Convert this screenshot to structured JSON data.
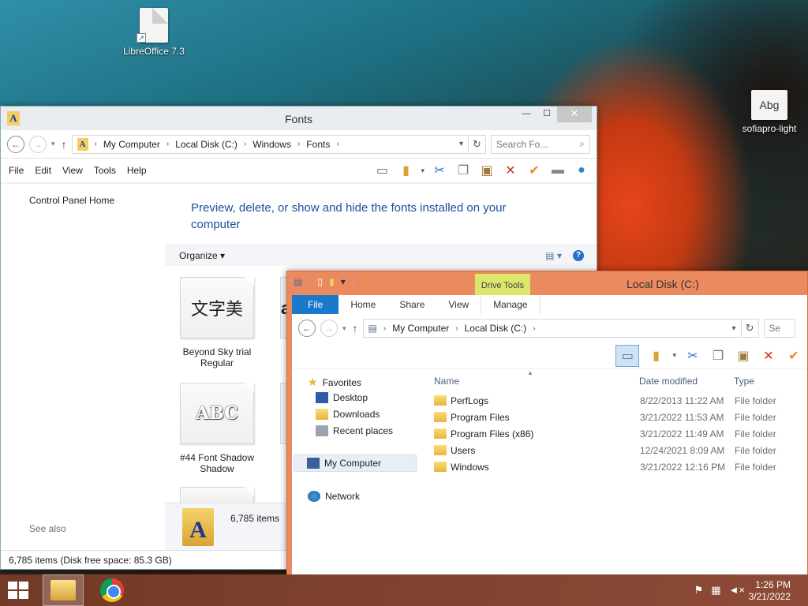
{
  "desktop": {
    "icons": [
      {
        "label": "LibreOffice 7.3"
      },
      {
        "label": "sofiapro-light",
        "glyph": "Abg"
      }
    ]
  },
  "fonts_window": {
    "title": "Fonts",
    "address": [
      "My Computer",
      "Local Disk (C:)",
      "Windows",
      "Fonts"
    ],
    "search_placeholder": "Search Fo...",
    "menu": [
      "File",
      "Edit",
      "View",
      "Tools",
      "Help"
    ],
    "left_pane": {
      "home": "Control Panel Home",
      "see_also": "See also"
    },
    "headline": "Preview, delete, or show and hide the fonts installed on your computer",
    "organize": "Organize",
    "fonts": [
      {
        "preview": "文字美",
        "name": "Beyond Sky trial Regular"
      },
      {
        "preview": "ABC",
        "name": "#44 Font Shadow Shadow"
      }
    ],
    "partial_previews": [
      "a"
    ],
    "details_count": "6,785 items",
    "status": "6,785 items (Disk free space: 85.3 GB)"
  },
  "disk_window": {
    "title": "Local Disk (C:)",
    "context_tab": "Drive Tools",
    "tabs": [
      "File",
      "Home",
      "Share",
      "View",
      "Manage"
    ],
    "address": [
      "My Computer",
      "Local Disk (C:)"
    ],
    "search_partial": "Se",
    "nav": {
      "favorites": "Favorites",
      "desktop": "Desktop",
      "downloads": "Downloads",
      "recent": "Recent places",
      "computer": "My Computer",
      "network": "Network"
    },
    "columns": {
      "name": "Name",
      "date": "Date modified",
      "type": "Type"
    },
    "rows": [
      {
        "name": "PerfLogs",
        "date": "8/22/2013 11:22 AM",
        "type": "File folder"
      },
      {
        "name": "Program Files",
        "date": "3/21/2022 11:53 AM",
        "type": "File folder"
      },
      {
        "name": "Program Files (x86)",
        "date": "3/21/2022 11:49 AM",
        "type": "File folder"
      },
      {
        "name": "Users",
        "date": "12/24/2021 8:09 AM",
        "type": "File folder"
      },
      {
        "name": "Windows",
        "date": "3/21/2022 12:16 PM",
        "type": "File folder"
      }
    ]
  },
  "taskbar": {
    "time": "1:26 PM",
    "date": "3/21/2022"
  },
  "colors": {
    "accent": "#1979ca",
    "disk_frame": "#eb8a5f",
    "drive_tools": "#d9e86a"
  }
}
